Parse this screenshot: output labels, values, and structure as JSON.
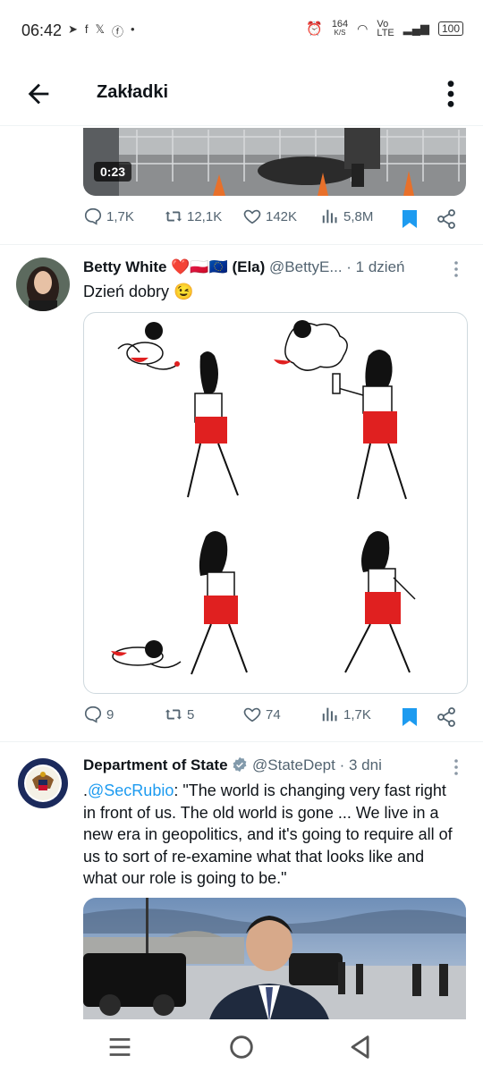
{
  "status_bar": {
    "time": "06:42",
    "speed_value": "164",
    "speed_unit": "K/S",
    "network_vo": "Vo",
    "network_lte": "LTE",
    "battery": "100"
  },
  "app_bar": {
    "title": "Zakładki"
  },
  "tweets": [
    {
      "video_duration": "0:23",
      "replies": "1,7K",
      "reposts": "12,1K",
      "likes": "142K",
      "views": "5,8M"
    },
    {
      "name": "Betty White ❤️🇵🇱🇪🇺 (Ela)",
      "handle": "@BettyE...",
      "time": "· 1 dzień",
      "text": "Dzień dobry 😉",
      "replies": "9",
      "reposts": "5",
      "likes": "74",
      "views": "1,7K"
    },
    {
      "name": "Department of State",
      "handle": "@StateDept",
      "time": "· 3 dni",
      "text_prefix": ".",
      "mention": "@SecRubio",
      "text": ": \"The world is changing very fast right in front of us. The old world is gone ... We live in a new era in geopolitics, and it's going to require all of us to sort of re-examine what that looks like and what our role is going to be.\""
    }
  ],
  "colors": {
    "accent": "#1d9bf0",
    "muted": "#536471",
    "text": "#0f1419"
  }
}
